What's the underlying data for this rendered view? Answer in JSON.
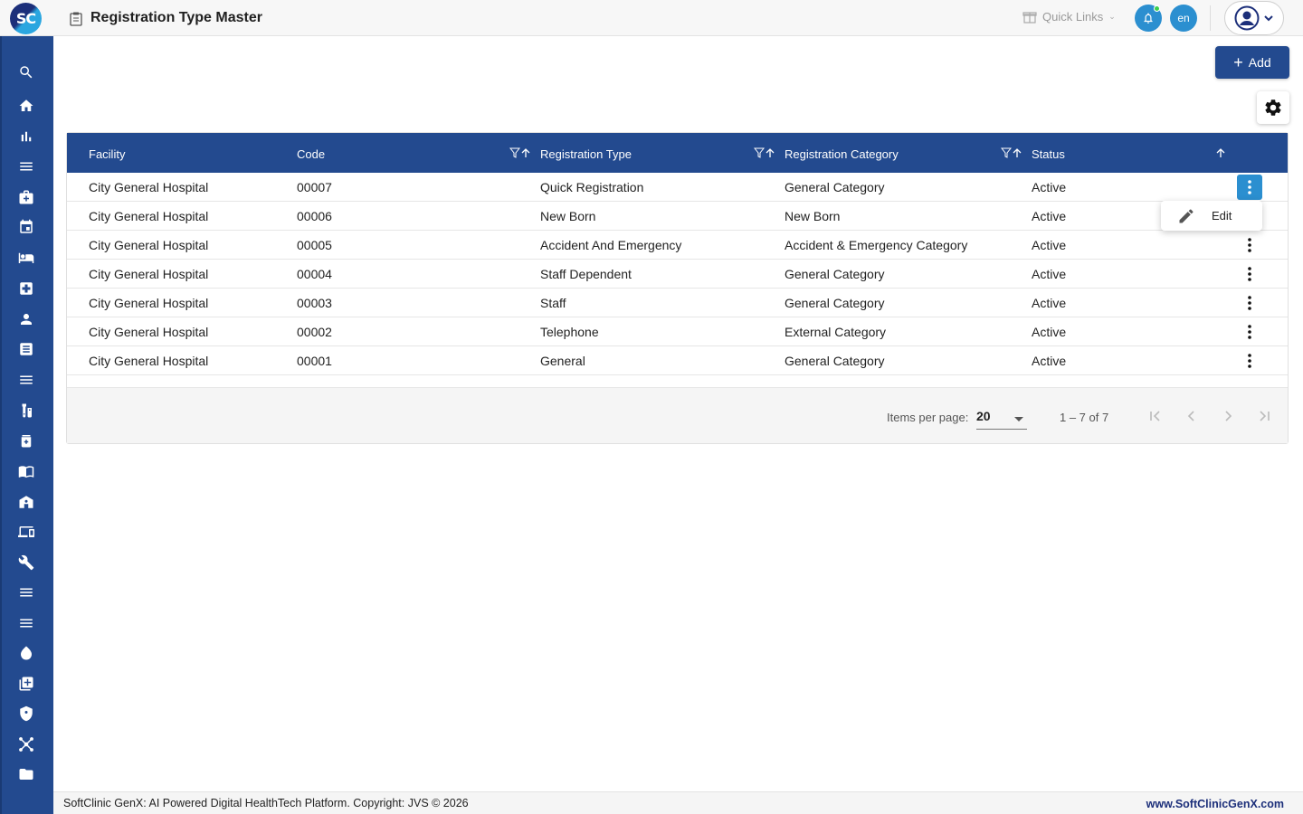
{
  "header": {
    "logo_text": "SC",
    "title": "Registration Type Master",
    "quick_links_label": "Quick Links",
    "language": "en"
  },
  "sidebar": {
    "items": [
      {
        "icon": "search-icon"
      },
      {
        "icon": "home-icon"
      },
      {
        "icon": "bar-chart-icon"
      },
      {
        "icon": "menu-icon"
      },
      {
        "icon": "medical-bag-icon"
      },
      {
        "icon": "calendar-icon"
      },
      {
        "icon": "bed-icon"
      },
      {
        "icon": "medical-cross-icon"
      },
      {
        "icon": "person-icon"
      },
      {
        "icon": "receipt-icon"
      },
      {
        "icon": "list-icon"
      },
      {
        "icon": "lab-icon"
      },
      {
        "icon": "pharmacy-icon"
      },
      {
        "icon": "book-icon"
      },
      {
        "icon": "store-icon"
      },
      {
        "icon": "devices-icon"
      },
      {
        "icon": "wrench-icon"
      },
      {
        "icon": "list-icon"
      },
      {
        "icon": "list-icon"
      },
      {
        "icon": "blood-drop-icon"
      },
      {
        "icon": "add-library-icon"
      },
      {
        "icon": "shield-icon"
      },
      {
        "icon": "network-icon"
      },
      {
        "icon": "folder-icon"
      }
    ]
  },
  "toolbar": {
    "add_label": "Add"
  },
  "table": {
    "columns": [
      "Facility",
      "Code",
      "Registration Type",
      "Registration Category",
      "Status"
    ],
    "rows": [
      {
        "facility": "City General Hospital",
        "code": "00007",
        "type": "Quick Registration",
        "category": "General Category",
        "status": "Active"
      },
      {
        "facility": "City General Hospital",
        "code": "00006",
        "type": "New Born",
        "category": "New Born",
        "status": "Active"
      },
      {
        "facility": "City General Hospital",
        "code": "00005",
        "type": "Accident And Emergency",
        "category": "Accident & Emergency Category",
        "status": "Active"
      },
      {
        "facility": "City General Hospital",
        "code": "00004",
        "type": "Staff Dependent",
        "category": "General Category",
        "status": "Active"
      },
      {
        "facility": "City General Hospital",
        "code": "00003",
        "type": "Staff",
        "category": "General Category",
        "status": "Active"
      },
      {
        "facility": "City General Hospital",
        "code": "00002",
        "type": "Telephone",
        "category": "External Category",
        "status": "Active"
      },
      {
        "facility": "City General Hospital",
        "code": "00001",
        "type": "General",
        "category": "General Category",
        "status": "Active"
      }
    ]
  },
  "row_menu": {
    "edit_label": "Edit"
  },
  "pager": {
    "items_per_page_label": "Items per page:",
    "items_per_page": "20",
    "range": "1 – 7 of 7"
  },
  "footer": {
    "copyright": "SoftClinic GenX: AI Powered Digital HealthTech Platform. Copyright: JVS © 2026",
    "website": "www.SoftClinicGenX.com"
  },
  "colors": {
    "primary": "#234a8f",
    "accent": "#2b8fd0",
    "notification_dot": "#3ccf4e"
  }
}
